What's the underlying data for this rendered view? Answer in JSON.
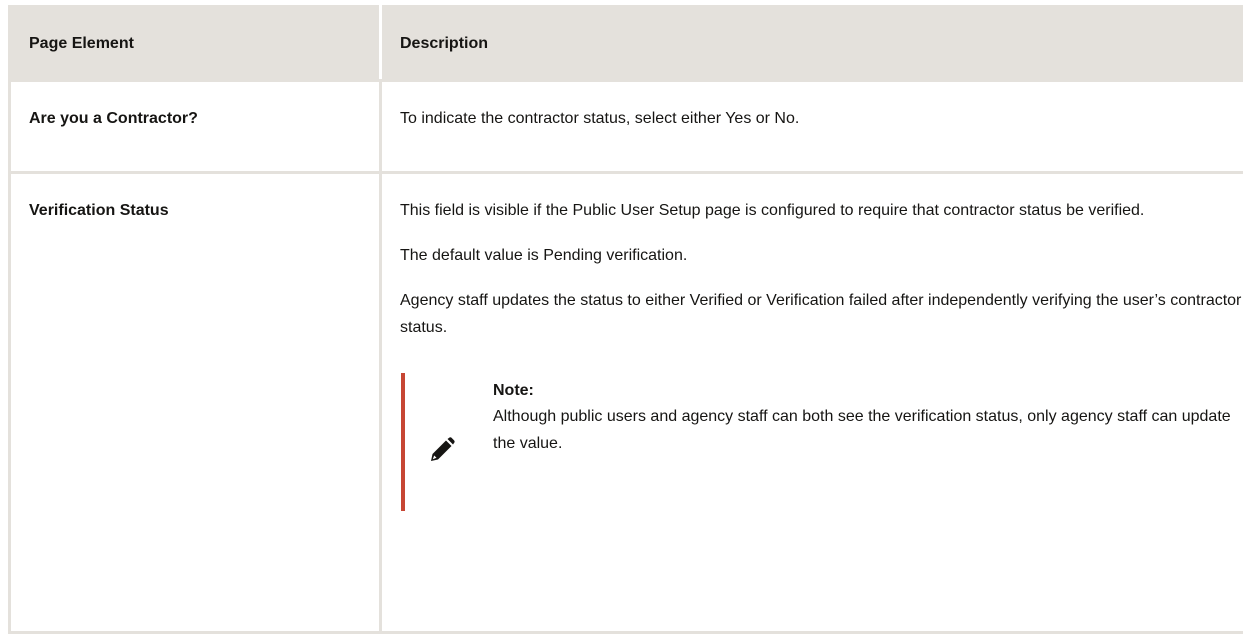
{
  "table": {
    "headers": [
      "Page Element",
      "Description"
    ],
    "rows": [
      {
        "element": "Are you a Contractor?",
        "paragraphs": [
          "To indicate the contractor status, select either Yes or No."
        ]
      },
      {
        "element": "Verification Status",
        "paragraphs": [
          "This field is visible if the Public User Setup page is configured to require that contractor status be verified.",
          "The default value is Pending verification.",
          "Agency staff updates the status to either Verified or Verification failed after independently verifying the user’s contractor status."
        ],
        "note": {
          "icon": "pencil-icon",
          "title": "Note:",
          "text": "Although public users and agency staff can both see the verification status, only agency staff can update the value."
        }
      }
    ]
  },
  "colors": {
    "header_bg": "#e4e1dc",
    "note_accent": "#c74634",
    "text": "#161513"
  }
}
